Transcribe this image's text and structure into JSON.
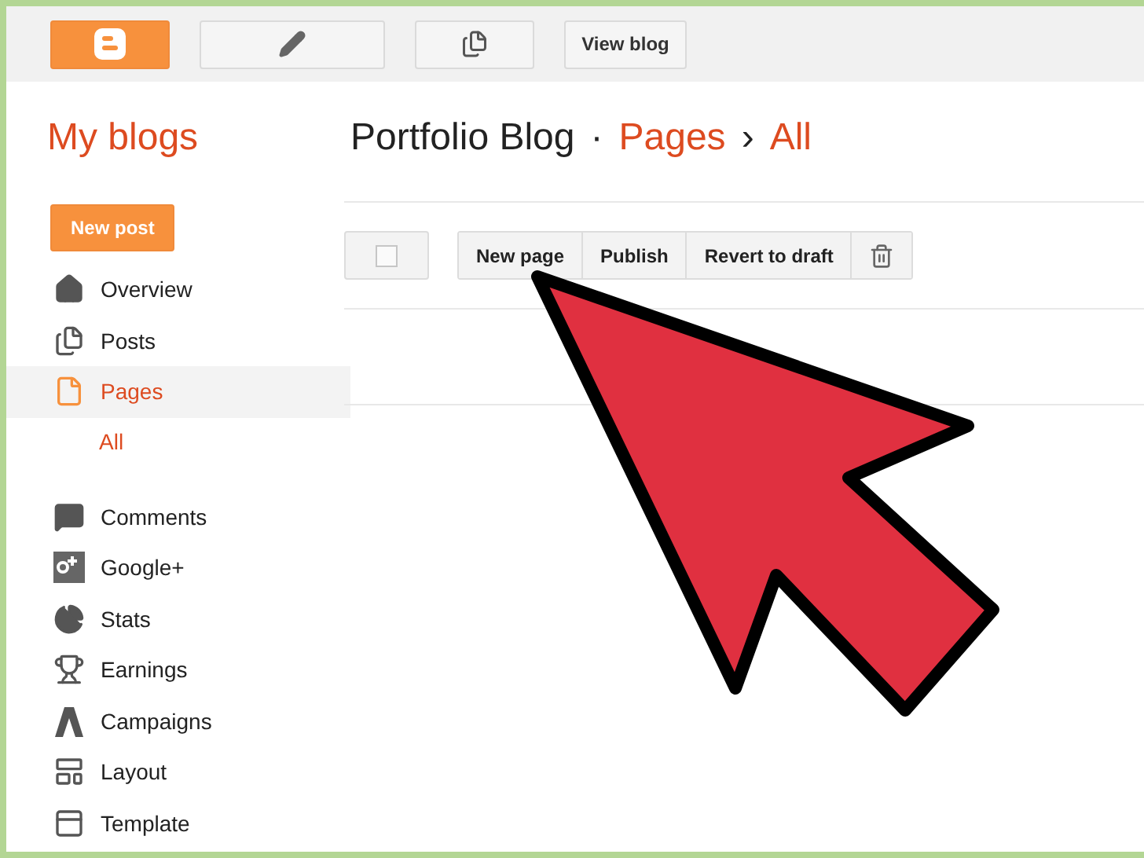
{
  "top_bar": {
    "view_blog": "View blog"
  },
  "sidebar": {
    "title": "My blogs",
    "new_post": "New post",
    "items": [
      {
        "label": "Overview",
        "selected": false
      },
      {
        "label": "Posts",
        "selected": false
      },
      {
        "label": "Pages",
        "selected": true,
        "children": [
          {
            "label": "All",
            "selected": true
          }
        ]
      },
      {
        "label": "Comments",
        "selected": false
      },
      {
        "label": "Google+",
        "selected": false
      },
      {
        "label": "Stats",
        "selected": false
      },
      {
        "label": "Earnings",
        "selected": false
      },
      {
        "label": "Campaigns",
        "selected": false
      },
      {
        "label": "Layout",
        "selected": false
      },
      {
        "label": "Template",
        "selected": false
      }
    ]
  },
  "breadcrumb": {
    "blog": "Portfolio Blog",
    "separator": "·",
    "section": "Pages",
    "arrow": "›",
    "current": "All"
  },
  "toolbar": {
    "select_all_checked": false,
    "buttons": [
      "New page",
      "Publish",
      "Revert to draft"
    ]
  }
}
